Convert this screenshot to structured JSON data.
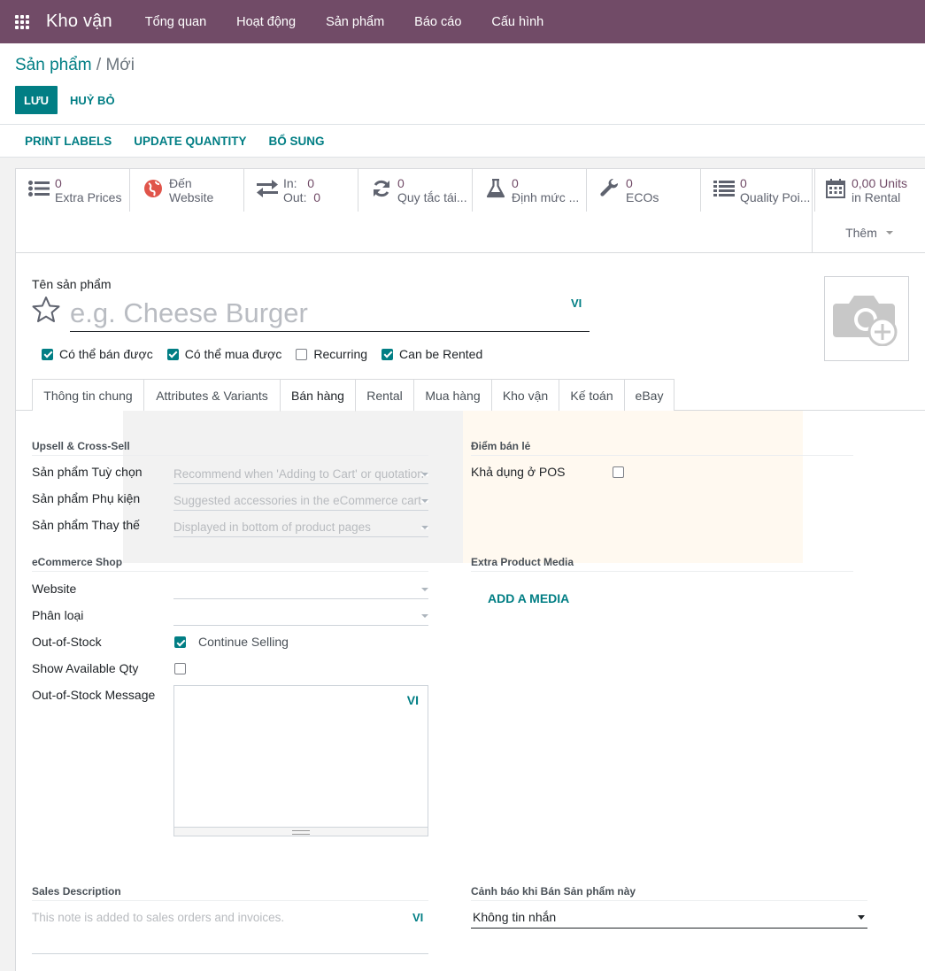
{
  "app": {
    "title": "Kho vận",
    "menu": [
      "Tổng quan",
      "Hoạt động",
      "Sản phẩm",
      "Báo cáo",
      "Cấu hình"
    ]
  },
  "breadcrumb": {
    "parent": "Sản phẩm",
    "separator": "/",
    "current": "Mới"
  },
  "buttons": {
    "save": "LƯU",
    "discard": "HUỶ BỎ"
  },
  "actions": [
    "PRINT LABELS",
    "UPDATE QUANTITY",
    "BỔ SUNG"
  ],
  "stat_buttons": [
    {
      "icon": "list-icon",
      "value": "0",
      "label": "Extra Prices"
    },
    {
      "icon": "globe-icon",
      "value": "Đến",
      "label": "Website"
    },
    {
      "icon": "exchange-icon",
      "in_label": "In:",
      "in_value": "0",
      "out_label": "Out:",
      "out_value": "0"
    },
    {
      "icon": "refresh-icon",
      "value": "0",
      "label": "Quy tắc tái..."
    },
    {
      "icon": "flask-icon",
      "value": "0",
      "label": "Định mức ..."
    },
    {
      "icon": "wrench-icon",
      "value": "0",
      "label": "ECOs"
    },
    {
      "icon": "list-icon",
      "value": "0",
      "label": "Quality Poi..."
    },
    {
      "icon": "calendar-icon",
      "value": "0,00 Units",
      "label": "in Rental"
    }
  ],
  "more_button": "Thêm",
  "product": {
    "name_label": "Tên sản phẩm",
    "name_placeholder": "e.g. Cheese Burger",
    "lang": "VI"
  },
  "checkboxes": [
    {
      "label": "Có thể bán được",
      "checked": true
    },
    {
      "label": "Có thể mua được",
      "checked": true
    },
    {
      "label": "Recurring",
      "checked": false
    },
    {
      "label": "Can be Rented",
      "checked": true
    }
  ],
  "tabs": [
    "Thông tin chung",
    "Attributes & Variants",
    "Bán hàng",
    "Rental",
    "Mua hàng",
    "Kho vận",
    "Kế toán",
    "eBay"
  ],
  "active_tab": "Bán hàng",
  "sales": {
    "upsell_title": "Upsell & Cross-Sell",
    "optional_label": "Sản phẩm Tuỳ chọn",
    "optional_placeholder": "Recommend when 'Adding to Cart' or quotation",
    "accessory_label": "Sản phẩm Phụ kiện",
    "accessory_placeholder": "Suggested accessories in the eCommerce cart",
    "alternative_label": "Sản phẩm Thay thế",
    "alternative_placeholder": "Displayed in bottom of product pages",
    "pos_title": "Điểm bán lẻ",
    "pos_label": "Khả dụng ở POS",
    "ecommerce_title": "eCommerce Shop",
    "website_label": "Website",
    "category_label": "Phân loại",
    "oos_label": "Out-of-Stock",
    "continue_selling": "Continue Selling",
    "show_qty_label": "Show Available Qty",
    "oos_message_label": "Out-of-Stock Message",
    "oos_lang": "VI",
    "media_title": "Extra Product Media",
    "add_media": "ADD A MEDIA",
    "sales_desc_title": "Sales Description",
    "sales_desc_placeholder": "This note is added to sales orders and invoices.",
    "sales_desc_lang": "VI",
    "warning_title": "Cảnh báo khi Bán Sản phẩm này",
    "warning_value": "Không tin nhắn"
  },
  "colors": {
    "brand": "#714b67",
    "accent": "#017e84"
  }
}
